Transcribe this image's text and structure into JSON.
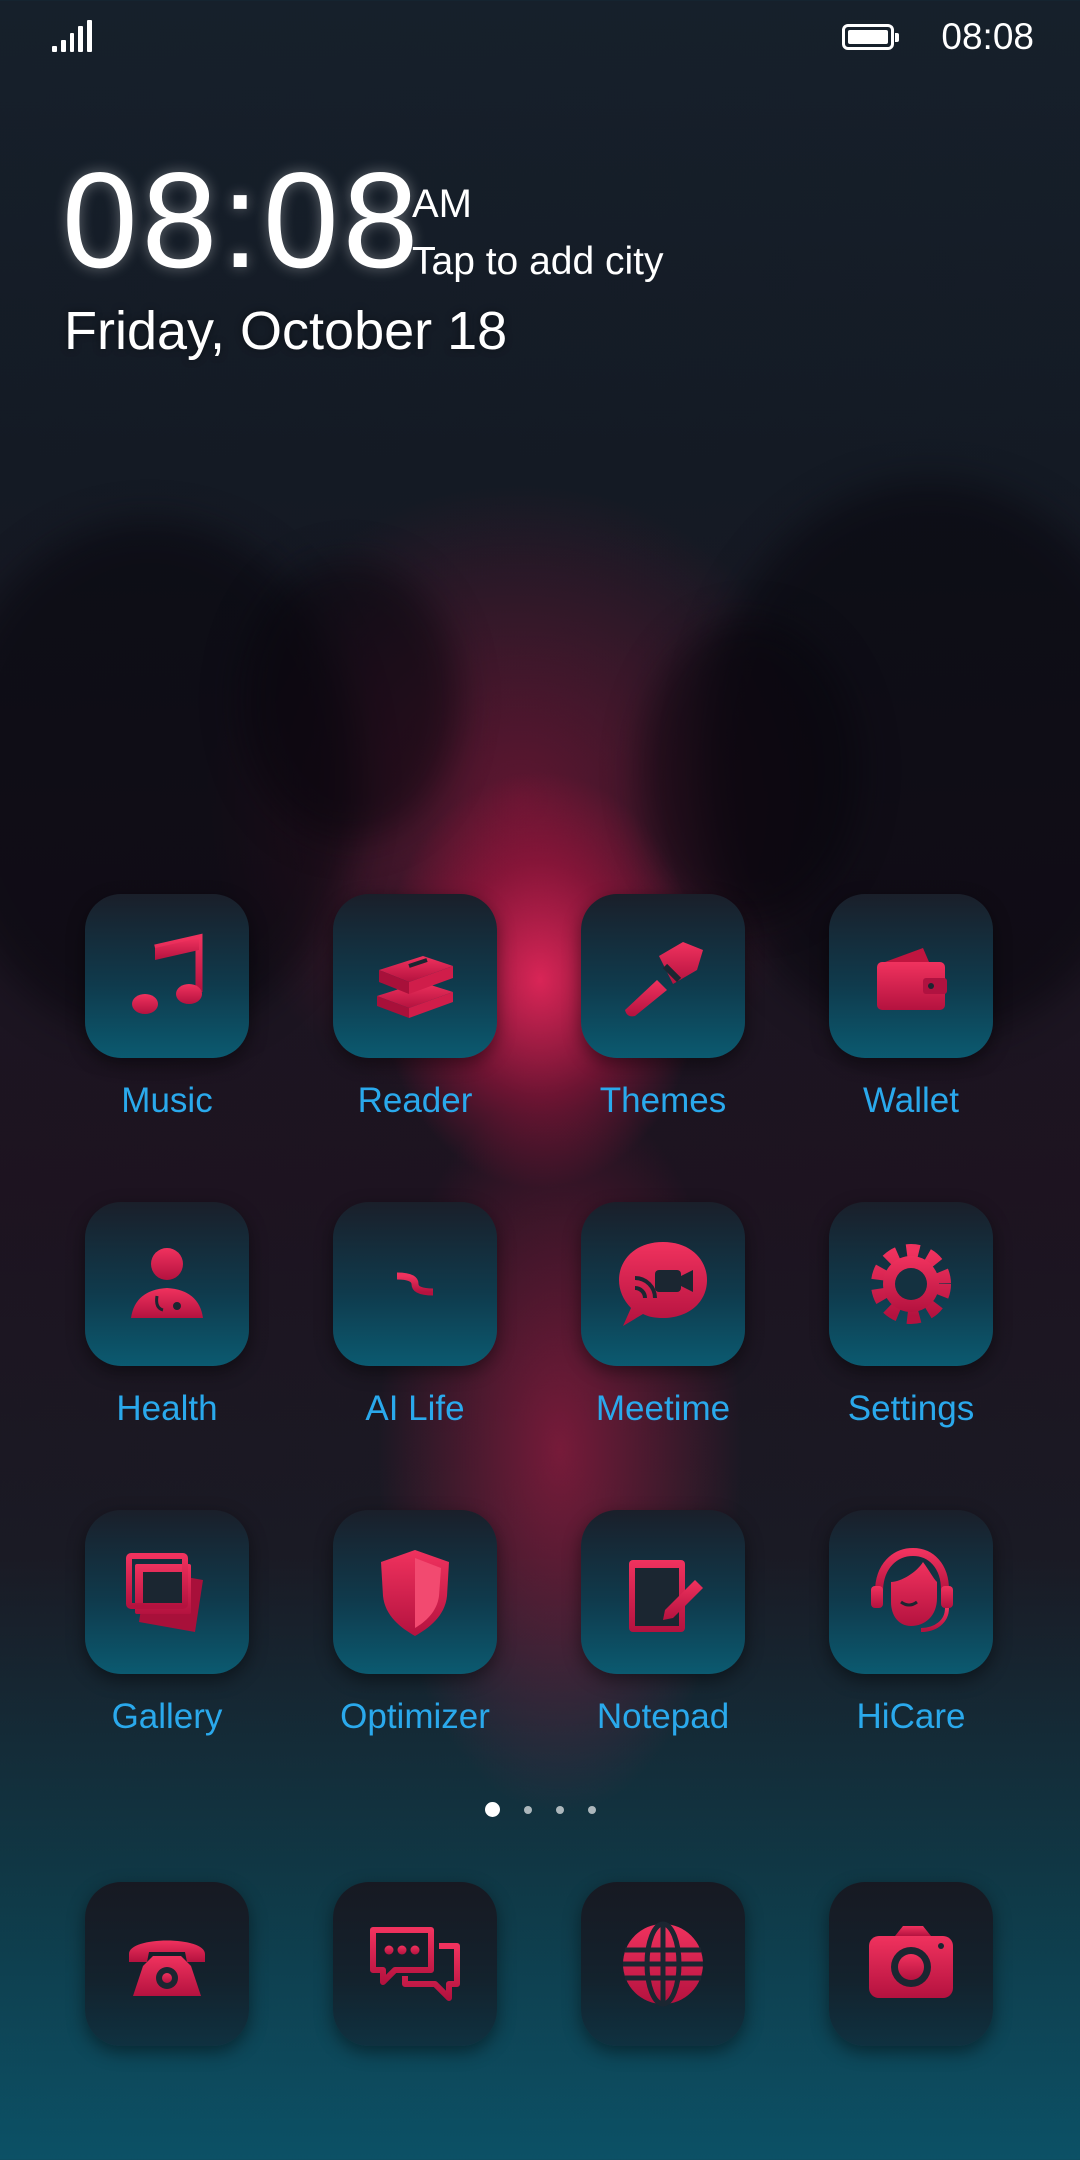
{
  "status_bar": {
    "time": "08:08",
    "signal_icon": "signal-icon",
    "battery_icon": "battery-icon"
  },
  "clock_widget": {
    "time": "08:08",
    "ampm": "AM",
    "city_prompt": "Tap to add city",
    "date": "Friday, October 18"
  },
  "apps": [
    {
      "label": "Music",
      "icon": "music-note-icon"
    },
    {
      "label": "Reader",
      "icon": "books-icon"
    },
    {
      "label": "Themes",
      "icon": "paintbrush-icon"
    },
    {
      "label": "Wallet",
      "icon": "wallet-icon"
    },
    {
      "label": "Health",
      "icon": "health-person-icon"
    },
    {
      "label": "AI Life",
      "icon": "ai-life-icon"
    },
    {
      "label": "Meetime",
      "icon": "video-chat-icon"
    },
    {
      "label": "Settings",
      "icon": "gear-icon"
    },
    {
      "label": "Gallery",
      "icon": "photos-icon"
    },
    {
      "label": "Optimizer",
      "icon": "shield-icon"
    },
    {
      "label": "Notepad",
      "icon": "notepad-icon"
    },
    {
      "label": "HiCare",
      "icon": "headset-icon"
    }
  ],
  "page_indicator": {
    "pages": 4,
    "current": 1
  },
  "dock": [
    {
      "icon": "phone-icon"
    },
    {
      "icon": "messages-icon"
    },
    {
      "icon": "browser-globe-icon"
    },
    {
      "icon": "camera-icon"
    }
  ],
  "colors": {
    "label": "#2aa9ec",
    "icon_red": "#e3234f",
    "tile_top": "#1a1f2a",
    "tile_bottom": "#0b5a70"
  }
}
